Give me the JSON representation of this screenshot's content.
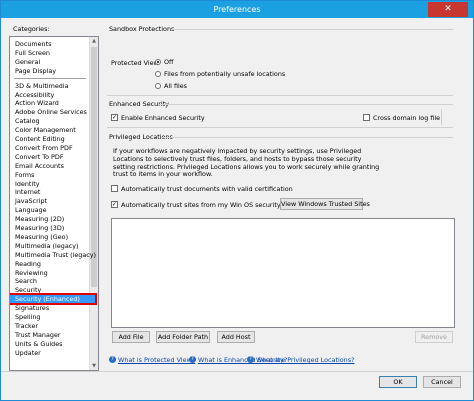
{
  "window": {
    "title": "Preferences",
    "close_glyph": "✕"
  },
  "categories": {
    "label": "Categories:",
    "group1": [
      "Documents",
      "Full Screen",
      "General",
      "Page Display"
    ],
    "group2": [
      "3D & Multimedia",
      "Accessibility",
      "Action Wizard",
      "Adobe Online Services",
      "Catalog",
      "Color Management",
      "Content Editing",
      "Convert From PDF",
      "Convert To PDF",
      "Email Accounts",
      "Forms",
      "Identity",
      "Internet",
      "JavaScript",
      "Language",
      "Measuring (2D)",
      "Measuring (3D)",
      "Measuring (Geo)",
      "Multimedia (legacy)",
      "Multimedia Trust (legacy)",
      "Reading",
      "Reviewing",
      "Search",
      "Security",
      "Security (Enhanced)",
      "Signatures",
      "Spelling",
      "Tracker",
      "Trust Manager",
      "Units & Guides",
      "Updater"
    ],
    "selected": "Security (Enhanced)"
  },
  "sandbox": {
    "title": "Sandbox Protections",
    "protected_view_label": "Protected View",
    "options": [
      "Off",
      "Files from potentially unsafe locations",
      "All files"
    ],
    "selected_option": "Off"
  },
  "enhanced": {
    "title": "Enhanced Security",
    "enable_label": "Enable Enhanced Security",
    "enable_checked": true,
    "cross_domain_label": "Cross domain log file",
    "cross_domain_checked": false
  },
  "privileged": {
    "title": "Privileged Locations",
    "description": "If your workflows are negatively impacted by security settings, use Privileged Locations to selectively trust files, folders, and hosts to bypass those security setting restrictions. Privileged Locations allows you to work securely while granting trust to items in your workflow.",
    "auto_cert_label": "Automatically trust documents with valid certification",
    "auto_cert_checked": false,
    "auto_win_label": "Automatically trust sites from my Win OS security zones",
    "auto_win_checked": true,
    "view_sites_button": "View Windows Trusted Sites",
    "add_file_button": "Add File",
    "add_folder_button": "Add Folder Path",
    "add_host_button": "Add Host",
    "remove_button": "Remove"
  },
  "help_links": [
    "What is Protected View?",
    "What is Enhanced Security?",
    "What are Privileged Locations?"
  ],
  "help_icon_glyph": "?",
  "check_glyph": "✓",
  "footer": {
    "ok_button": "OK",
    "cancel_button": "Cancel"
  }
}
